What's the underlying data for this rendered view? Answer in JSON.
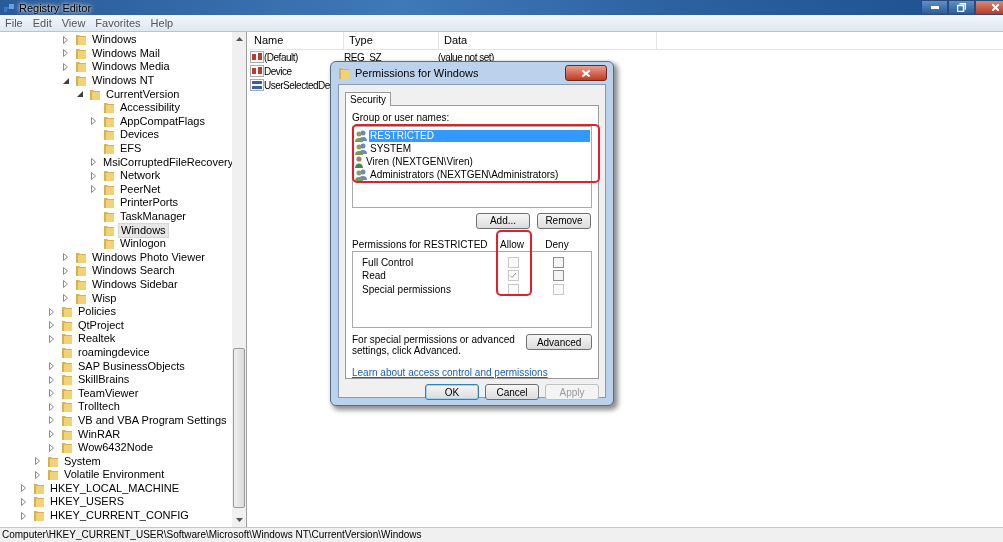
{
  "window": {
    "title": "Registry Editor"
  },
  "menu": [
    "File",
    "Edit",
    "View",
    "Favorites",
    "Help"
  ],
  "tree": [
    {
      "children": [
        {
          "children": [
            {
              "children": [
                {
                  "children": [
                    {
                      "label": "Windows",
                      "expanded": false,
                      "selected": false
                    },
                    {
                      "label": "Windows Mail",
                      "expanded": false,
                      "selected": false
                    },
                    {
                      "label": "Windows Media",
                      "expanded": false,
                      "selected": false
                    },
                    {
                      "label": "Windows NT",
                      "expanded": true,
                      "selected": false,
                      "children": [
                        {
                          "label": "CurrentVersion",
                          "expanded": true,
                          "selected": false,
                          "children": [
                            {
                              "label": "Accessibility",
                              "selected": false
                            },
                            {
                              "label": "AppCompatFlags",
                              "expanded": false,
                              "selected": false
                            },
                            {
                              "label": "Devices",
                              "selected": false
                            },
                            {
                              "label": "EFS",
                              "selected": false
                            },
                            {
                              "label": "MsiCorruptedFileRecovery",
                              "expanded": false,
                              "selected": false
                            },
                            {
                              "label": "Network",
                              "expanded": false,
                              "selected": false
                            },
                            {
                              "label": "PeerNet",
                              "expanded": false,
                              "selected": false
                            },
                            {
                              "label": "PrinterPorts",
                              "selected": false
                            },
                            {
                              "label": "TaskManager",
                              "selected": false
                            },
                            {
                              "label": "Windows",
                              "selected": true
                            },
                            {
                              "label": "Winlogon",
                              "selected": false
                            }
                          ]
                        }
                      ]
                    },
                    {
                      "label": "Windows Photo Viewer",
                      "expanded": false,
                      "selected": false
                    },
                    {
                      "label": "Windows Search",
                      "expanded": false,
                      "selected": false
                    },
                    {
                      "label": "Windows Sidebar",
                      "expanded": false,
                      "selected": false
                    },
                    {
                      "label": "Wisp",
                      "expanded": false,
                      "selected": false
                    }
                  ]
                },
                {
                  "label": "Policies",
                  "expanded": false,
                  "selected": false
                },
                {
                  "label": "QtProject",
                  "expanded": false,
                  "selected": false
                },
                {
                  "label": "Realtek",
                  "expanded": false,
                  "selected": false
                },
                {
                  "label": "roamingdevice",
                  "selected": false
                },
                {
                  "label": "SAP BusinessObjects",
                  "expanded": false,
                  "selected": false
                },
                {
                  "label": "SkillBrains",
                  "expanded": false,
                  "selected": false
                },
                {
                  "label": "TeamViewer",
                  "expanded": false,
                  "selected": false
                },
                {
                  "label": "Trolltech",
                  "expanded": false,
                  "selected": false
                },
                {
                  "label": "VB and VBA Program Settings",
                  "expanded": false,
                  "selected": false
                },
                {
                  "label": "WinRAR",
                  "expanded": false,
                  "selected": false
                },
                {
                  "label": "Wow6432Node",
                  "expanded": false,
                  "selected": false
                }
              ]
            },
            {
              "label": "System",
              "expanded": false,
              "selected": false
            },
            {
              "label": "Volatile Environment",
              "expanded": false,
              "selected": false
            }
          ]
        },
        {
          "label": "HKEY_LOCAL_MACHINE",
          "expanded": false,
          "selected": false
        },
        {
          "label": "HKEY_USERS",
          "expanded": false,
          "selected": false
        },
        {
          "label": "HKEY_CURRENT_CONFIG",
          "expanded": false,
          "selected": false
        }
      ]
    }
  ],
  "values": {
    "columns": [
      "Name",
      "Type",
      "Data"
    ],
    "rows": [
      {
        "kind": "string",
        "name": "(Default)",
        "type": "REG_SZ",
        "data": "(value not set)"
      },
      {
        "kind": "string",
        "name": "Device"
      },
      {
        "kind": "binary",
        "name": "UserSelectedDe"
      }
    ]
  },
  "dialog": {
    "title": "Permissions for Windows",
    "tab": "Security",
    "group_label": "Group or user names:",
    "users": [
      {
        "name": "RESTRICTED",
        "kind": "group",
        "selected": true
      },
      {
        "name": "SYSTEM",
        "kind": "group",
        "selected": false
      },
      {
        "name": "Viren (NEXTGEN\\Viren)",
        "kind": "user",
        "selected": false
      },
      {
        "name": "Administrators (NEXTGEN\\Administrators)",
        "kind": "group",
        "selected": false
      }
    ],
    "user_buttons": [
      "Add...",
      "Remove"
    ],
    "perm_heading": "Permissions for RESTRICTED",
    "allow_heading": "Allow",
    "deny_heading": "Deny",
    "permissions": [
      {
        "label": "Full Control",
        "allow": {
          "checked": false,
          "disabled": true
        },
        "deny": {
          "checked": false,
          "disabled": false
        }
      },
      {
        "label": "Read",
        "allow": {
          "checked": true,
          "disabled": true
        },
        "deny": {
          "checked": false,
          "disabled": false
        }
      },
      {
        "label": "Special permissions",
        "allow": {
          "checked": false,
          "disabled": true
        },
        "deny": {
          "checked": false,
          "disabled": true
        }
      }
    ],
    "advanced_note": "For special permissions or advanced settings, click Advanced.",
    "advanced_button": "Advanced",
    "link": "Learn about access control and permissions",
    "buttons": [
      {
        "label": "OK",
        "kind": "default",
        "disabled": false
      },
      {
        "label": "Cancel",
        "kind": "normal",
        "disabled": false
      },
      {
        "label": "Apply",
        "kind": "normal",
        "disabled": true
      }
    ]
  },
  "status_bar": "Computer\\HKEY_CURRENT_USER\\Software\\Microsoft\\Windows NT\\CurrentVersion\\Windows"
}
